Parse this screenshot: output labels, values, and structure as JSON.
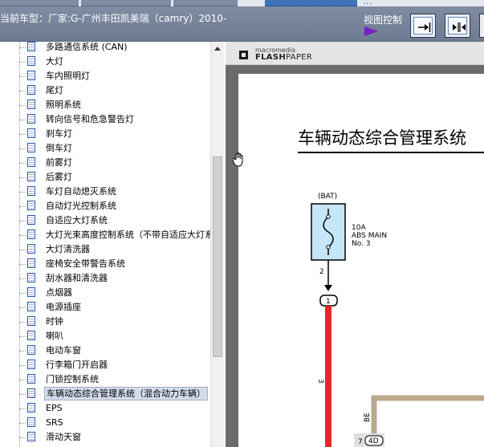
{
  "header": {
    "title": "当前车型：厂家:G-广州丰田凯美瑞（camry）2010-",
    "view_control_label": "视图控制",
    "overflow_indicator": "..."
  },
  "tree": {
    "items": [
      {
        "label": "多路通信系统 (CAN)"
      },
      {
        "label": "大灯"
      },
      {
        "label": "车内照明灯"
      },
      {
        "label": "尾灯"
      },
      {
        "label": "照明系统"
      },
      {
        "label": "转向信号和危急警告灯"
      },
      {
        "label": "刹车灯"
      },
      {
        "label": "倒车灯"
      },
      {
        "label": "前雾灯"
      },
      {
        "label": "后雾灯"
      },
      {
        "label": "车灯自动熄灭系统"
      },
      {
        "label": "自动灯光控制系统"
      },
      {
        "label": "自适应大灯系统"
      },
      {
        "label": "大灯光束高度控制系统（不带自适应大灯系"
      },
      {
        "label": "大灯清洗器"
      },
      {
        "label": "座椅安全带警告系统"
      },
      {
        "label": "刮水器和清洗器"
      },
      {
        "label": "点烟器"
      },
      {
        "label": "电源插座"
      },
      {
        "label": "时钟"
      },
      {
        "label": "喇叭"
      },
      {
        "label": "电动车窗"
      },
      {
        "label": "行李箱门开启器"
      },
      {
        "label": "门锁控制系统"
      },
      {
        "label": "车辆动态综合管理系统（混合动力车辆）",
        "selected": true
      },
      {
        "label": "EPS"
      },
      {
        "label": "SRS"
      },
      {
        "label": "滑动天窗"
      }
    ]
  },
  "viewer": {
    "brand_line1": "macromedia",
    "brand_line2_a": "FLASH",
    "brand_line2_b": "PAPER"
  },
  "diagram": {
    "heading": "车辆动态综合管理系统",
    "source_label": "(BAT)",
    "fuse_line1": "10A",
    "fuse_line2": "ABS MAIN",
    "fuse_line3": "No. 3",
    "pin_top": "2",
    "connector_pin": "1",
    "wire_ref": "3",
    "wire_color": "BE",
    "bottom_pin": "7",
    "bottom_connector": "4D"
  },
  "colors": {
    "header_bg": "#7b889e",
    "selected_item_bg": "#d4dcea",
    "wire_red": "#e8262c",
    "wire_beige": "#bca88e",
    "play_purple": "#7a1ec8"
  }
}
